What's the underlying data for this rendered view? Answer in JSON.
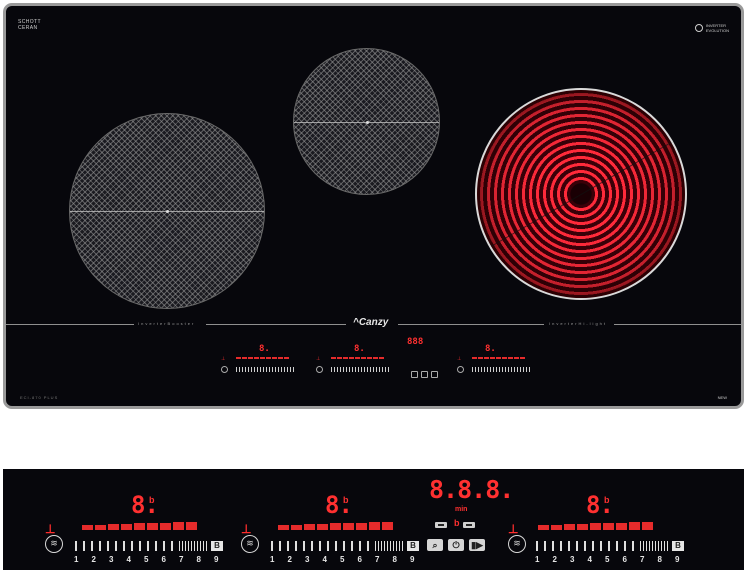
{
  "cooktop": {
    "brand_top_left": [
      "SCHOTT",
      "CERAN"
    ],
    "brand_top_right": [
      "INVERTER",
      "EVOLUTION"
    ],
    "left_section_label": "InverterBooster",
    "right_section_label": "InverterHi-light",
    "logo": "^Canzy",
    "model": "ECI-870 PLUS",
    "badge": "NEW",
    "mini_digit": "8.",
    "mini_timer": "888"
  },
  "panel": {
    "zone_digit": "8.",
    "boost_mark": "b",
    "scale_numbers": [
      "1",
      "2",
      "3",
      "4",
      "5",
      "6",
      "7",
      "8",
      "9"
    ],
    "boost_box": "B",
    "timer_digits": "8.8.8.",
    "timer_unit": "min",
    "icons": {
      "zone": "burner-icon",
      "lock": "child-lock-icon",
      "search": "search-icon",
      "power": "power-icon",
      "pause": "pause-play-icon"
    },
    "power_bar_levels": [
      0.3,
      0.4,
      0.5,
      0.6,
      0.7,
      0.75,
      0.8,
      0.9,
      1.0
    ]
  },
  "colors": {
    "glass": "#07070c",
    "indicator_red": "#e52b2b",
    "frame": "#9a9a9a"
  }
}
